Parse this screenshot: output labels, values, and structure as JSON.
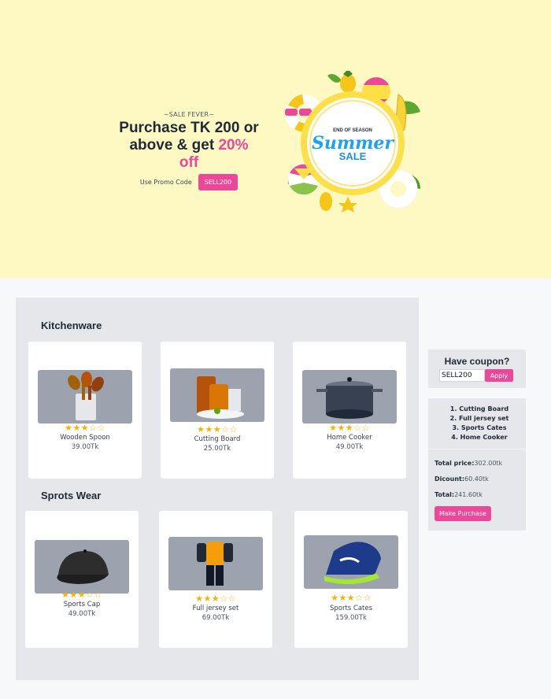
{
  "hero": {
    "eyebrow": "~SALE FEVER~",
    "headline_line1": "Purchase TK 200 or",
    "headline_line2_prefix": "above & get ",
    "headline_accent": "20% off",
    "promo_label": "Use Promo Code",
    "promo_code": "SELL200",
    "badge_top": "END OF SEASON",
    "badge_script": "Summer",
    "badge_bottom": "SALE"
  },
  "sections": [
    {
      "title": "Kitchenware",
      "products": [
        {
          "name": "Wooden Spoon",
          "price": "39.00Tk",
          "rating": 3,
          "max_rating": 5,
          "icon": "wooden-spoons"
        },
        {
          "name": "Cutting Board",
          "price": "25.00Tk",
          "rating": 3,
          "max_rating": 5,
          "icon": "cutting-board"
        },
        {
          "name": "Home Cooker",
          "price": "49.00Tk",
          "rating": 3,
          "max_rating": 5,
          "icon": "cooking-pot"
        }
      ]
    },
    {
      "title": "Sprots Wear",
      "products": [
        {
          "name": "Sports Cap",
          "price": "49.00Tk",
          "rating": 3,
          "max_rating": 5,
          "icon": "cap"
        },
        {
          "name": "Full jersey set",
          "price": "69.00Tk",
          "rating": 3,
          "max_rating": 5,
          "icon": "jersey"
        },
        {
          "name": "Sports Cates",
          "price": "159.00Tk",
          "rating": 3,
          "max_rating": 5,
          "icon": "sneaker"
        }
      ]
    }
  ],
  "coupon": {
    "title": "Have coupon?",
    "input_value": "SELL200",
    "apply_label": "Apply"
  },
  "summary": {
    "items": [
      "1. Cutting Board",
      "2. Full jersey set",
      "3. Sports Cates",
      "4. Home Cooker"
    ],
    "total_price_label": "Total price:",
    "total_price_value": "302.00tk",
    "discount_label": "Dicount:",
    "discount_value": "60.40tk",
    "total_label": "Total:",
    "total_value": "241.60tk",
    "purchase_label": "Make Purchase"
  },
  "colors": {
    "accent": "#ec4899",
    "hero_bg": "#fef9c3",
    "star": "#f5b301"
  }
}
